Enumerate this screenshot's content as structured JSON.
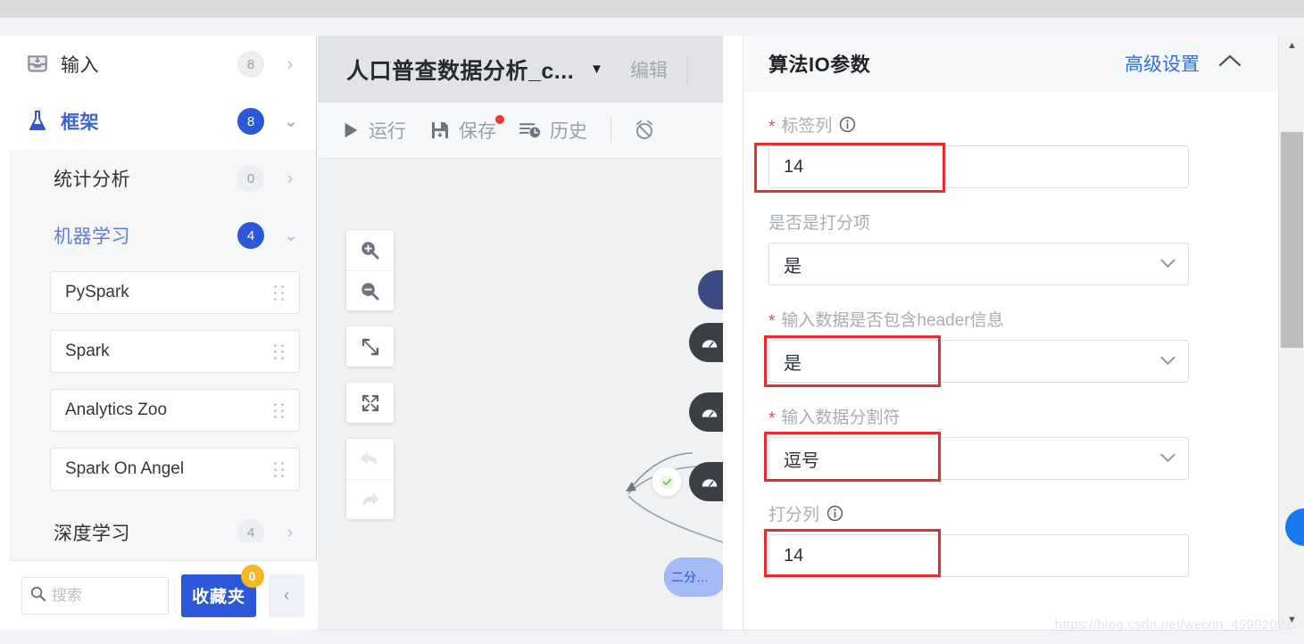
{
  "sidebar": {
    "items": [
      {
        "label": "输入",
        "badge": "8",
        "badge_style": "grey",
        "chevron": "›",
        "icon": "inbox-icon",
        "level": 0
      },
      {
        "label": "框架",
        "badge": "8",
        "badge_style": "blue",
        "chevron": "⌄",
        "icon": "flask-icon",
        "level": 0
      },
      {
        "label": "统计分析",
        "badge": "0",
        "badge_style": "grey",
        "chevron": "›",
        "icon": "",
        "level": 1
      },
      {
        "label": "机器学习",
        "badge": "4",
        "badge_style": "blue",
        "chevron": "⌄",
        "icon": "",
        "level": 1
      },
      {
        "label": "深度学习",
        "badge": "4",
        "badge_style": "grey",
        "chevron": "›",
        "icon": "",
        "level": 1
      }
    ],
    "cards": [
      {
        "label": "PySpark"
      },
      {
        "label": "Spark"
      },
      {
        "label": "Analytics Zoo"
      },
      {
        "label": "Spark On Angel"
      }
    ],
    "footer": {
      "search_placeholder": "搜索",
      "search_value": "",
      "favorites_label": "收藏夹",
      "favorites_count": "0",
      "collapse_label": "‹"
    }
  },
  "center": {
    "title": "人口普查数据分析_c...",
    "title_caret": "▼",
    "edit_label": "编辑",
    "toolbar": [
      {
        "label": "运行",
        "icon": "play-icon",
        "dot": false
      },
      {
        "label": "保存",
        "icon": "save-icon",
        "dot": true
      },
      {
        "label": "历史",
        "icon": "history-icon",
        "dot": false
      },
      {
        "label": "",
        "icon": "alarm-icon",
        "dot": false
      }
    ],
    "canvas_tools": [
      {
        "name": "zoom-in-icon"
      },
      {
        "name": "zoom-out-icon"
      },
      {
        "name": "fit-diagonal-icon"
      },
      {
        "name": "fullscreen-icon"
      },
      {
        "name": "undo-icon"
      },
      {
        "name": "redo-icon"
      }
    ],
    "nodes": [
      {
        "type": "navy"
      },
      {
        "type": "dark"
      },
      {
        "type": "dark"
      },
      {
        "type": "dark",
        "status": "ok"
      },
      {
        "type": "blue",
        "label": "二分…"
      }
    ]
  },
  "right_panel": {
    "title": "算法IO参数",
    "advanced_label": "高级设置",
    "collapse_icon": "chevron-up-icon",
    "fields": [
      {
        "label": "标签列",
        "required": true,
        "info": true,
        "kind": "input",
        "value": "14",
        "highlight": true
      },
      {
        "label": "是否是打分项",
        "required": false,
        "info": false,
        "kind": "select",
        "value": "是",
        "highlight": false
      },
      {
        "label": "输入数据是否包含header信息",
        "required": true,
        "info": false,
        "kind": "select",
        "value": "是",
        "highlight": true
      },
      {
        "label": "输入数据分割符",
        "required": true,
        "info": false,
        "kind": "select",
        "value": "逗号",
        "highlight": true
      },
      {
        "label": "打分列",
        "required": false,
        "info": true,
        "kind": "input",
        "value": "14",
        "highlight": true
      }
    ]
  },
  "scrollbar": {
    "up_arrow": "▲",
    "down_arrow": "▼"
  },
  "watermark": "https://blog.csdn.net/weixin_45992021",
  "colors": {
    "accent_blue": "#2b57d8",
    "link_blue": "#2f6fe4",
    "highlight_red": "#ee2b2b",
    "required_red": "#ef4b4b",
    "badge_amber": "#f6b724",
    "fab_blue": "#1778f2",
    "node_dark": "#3b3f45",
    "node_navy": "#3d4a82"
  }
}
